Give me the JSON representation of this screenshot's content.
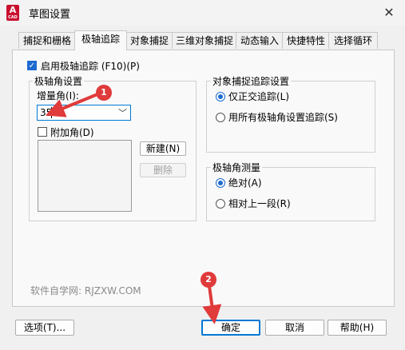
{
  "window": {
    "title": "草图设置",
    "close_glyph": "✕"
  },
  "app_icon": {
    "letter": "A",
    "sub": "CAD"
  },
  "tabs": [
    {
      "label": "捕捉和栅格"
    },
    {
      "label": "极轴追踪"
    },
    {
      "label": "对象捕捉"
    },
    {
      "label": "三维对象捕捉"
    },
    {
      "label": "动态输入"
    },
    {
      "label": "快捷特性"
    },
    {
      "label": "选择循环"
    }
  ],
  "polar": {
    "enable_label": "启用极轴追踪 (F10)(P)",
    "enabled": true,
    "angle_settings": {
      "title": "极轴角设置",
      "increment_label": "增量角(I):",
      "increment_value": "35",
      "additional_label": "附加角(D)",
      "additional_checked": false,
      "new_button": "新建(N)",
      "delete_button": "删除"
    },
    "object_snap": {
      "title": "对象捕捉追踪设置",
      "options": [
        "仅正交追踪(L)",
        "用所有极轴角设置追踪(S)"
      ],
      "selected": 0
    },
    "measurement": {
      "title": "极轴角测量",
      "options": [
        "绝对(A)",
        "相对上一段(R)"
      ],
      "selected": 0
    }
  },
  "watermark": "软件自学网: RJZXW.COM",
  "footer": {
    "options_button": "选项(T)...",
    "ok_button": "确定",
    "cancel_button": "取消",
    "help_button": "帮助(H)"
  },
  "annotations": {
    "marker_1": "1",
    "marker_2": "2",
    "color": "#e03a3a"
  },
  "colors": {
    "accent": "#1d6ad0",
    "focus": "#0078d4"
  }
}
